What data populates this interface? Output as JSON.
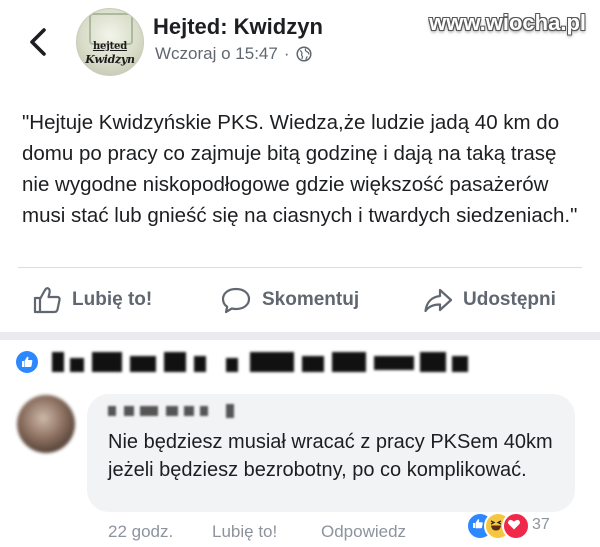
{
  "header": {
    "back_icon": "chevron-left-icon",
    "page_name": "Hejted: Kwidzyn",
    "timestamp": "Wczoraj o 15:47",
    "separator": "·",
    "privacy_icon": "globe-icon",
    "avatar": {
      "line1": "hejted",
      "line2": "Kwidzyn"
    }
  },
  "watermark": "www.wiocha.pl",
  "post": {
    "text": "\"Hejtuje Kwidzyńskie PKS. Wiedza,że ludzie jadą 40 km do domu po pracy co zajmuje bitą godzinę i dają na taką trasę nie wygodne niskopodłogowe gdzie większość pasażerów musi stać lub gnieść się na ciasnych i twardych siedzeniach.\""
  },
  "actions": {
    "like_label": "Lubię to!",
    "comment_label": "Skomentuj",
    "share_label": "Udostępni"
  },
  "reactors_row": {
    "icon": "like-reaction-icon",
    "names_blurred": true
  },
  "comment": {
    "author_blurred": true,
    "text": "Nie będziesz musiał wracać z pracy PKSem 40km jeżeli będziesz bezrobotny, po co komplikować.",
    "time": "22 godz.",
    "like_label": "Lubię to!",
    "reply_label": "Odpowiedz",
    "reaction_count": "37",
    "reactions": [
      "like",
      "haha",
      "love"
    ]
  },
  "colors": {
    "fb_blue": "#2d88ff",
    "secondary_text": "#606770",
    "bubble": "#f2f3f5",
    "haha": "#f7c641",
    "love": "#f0284a"
  }
}
